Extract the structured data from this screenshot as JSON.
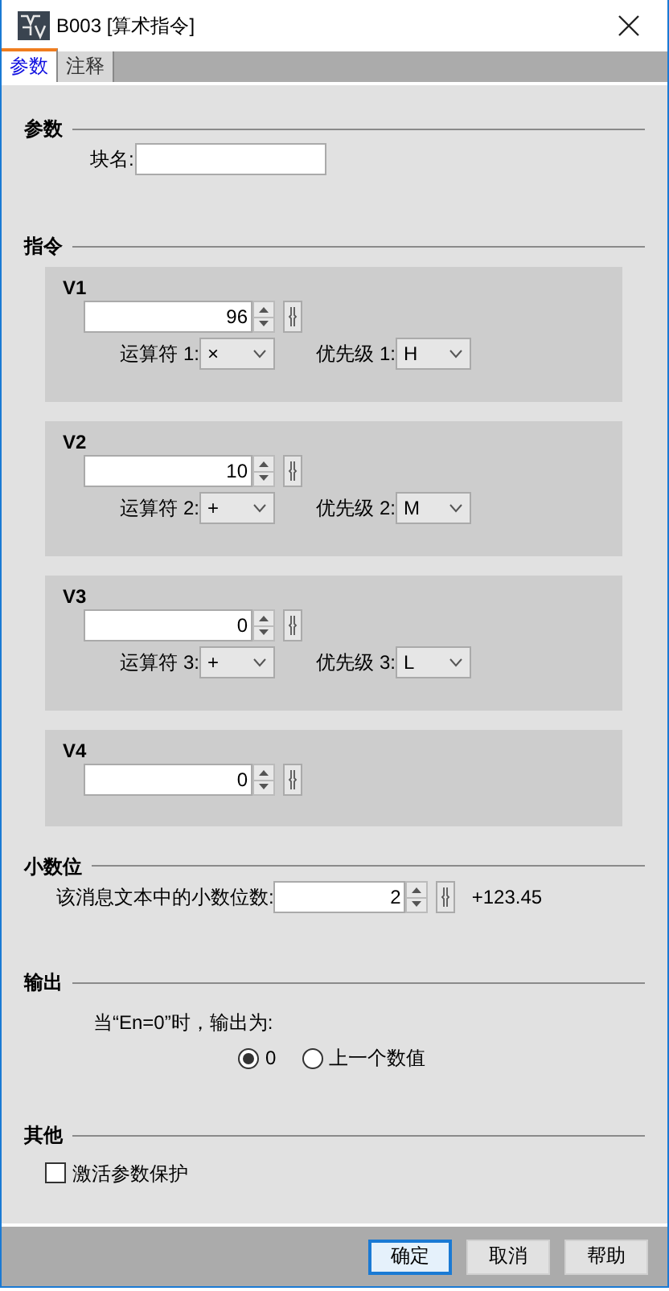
{
  "window": {
    "title": "B003 [算术指令]"
  },
  "tabs": [
    {
      "label": "参数",
      "selected": true
    },
    {
      "label": "注释",
      "selected": false
    }
  ],
  "parameters": {
    "heading": "参数",
    "block_name": {
      "label": "块名:"
    }
  },
  "instruction": {
    "heading": "指令",
    "values": [
      {
        "title": "V1",
        "value": "96",
        "operator": {
          "label": "运算符 1:",
          "value": "×"
        },
        "priority": {
          "label": "优先级 1:",
          "value": "H"
        }
      },
      {
        "title": "V2",
        "value": "10",
        "operator": {
          "label": "运算符 2:",
          "value": "+"
        },
        "priority": {
          "label": "优先级 2:",
          "value": "M"
        }
      },
      {
        "title": "V3",
        "value": "0",
        "operator": {
          "label": "运算符 3:",
          "value": "+"
        },
        "priority": {
          "label": "优先级 3:",
          "value": "L"
        }
      },
      {
        "title": "V4",
        "value": "0"
      }
    ]
  },
  "decimals": {
    "heading": "小数位",
    "label": "该消息文本中的小数位数:",
    "value": "2",
    "preview": "+123.45"
  },
  "output": {
    "heading": "输出",
    "prompt": "当“En=0”时，输出为:",
    "options": [
      {
        "label": "0",
        "selected": true
      },
      {
        "label": "上一个数值",
        "selected": false
      }
    ]
  },
  "other": {
    "heading": "其他",
    "options": [
      {
        "label": "激活参数保护",
        "checked": false
      }
    ]
  },
  "buttons": [
    {
      "label": "确定",
      "selected": true
    },
    {
      "label": "取消",
      "selected": false
    },
    {
      "label": "帮助",
      "selected": false
    }
  ]
}
